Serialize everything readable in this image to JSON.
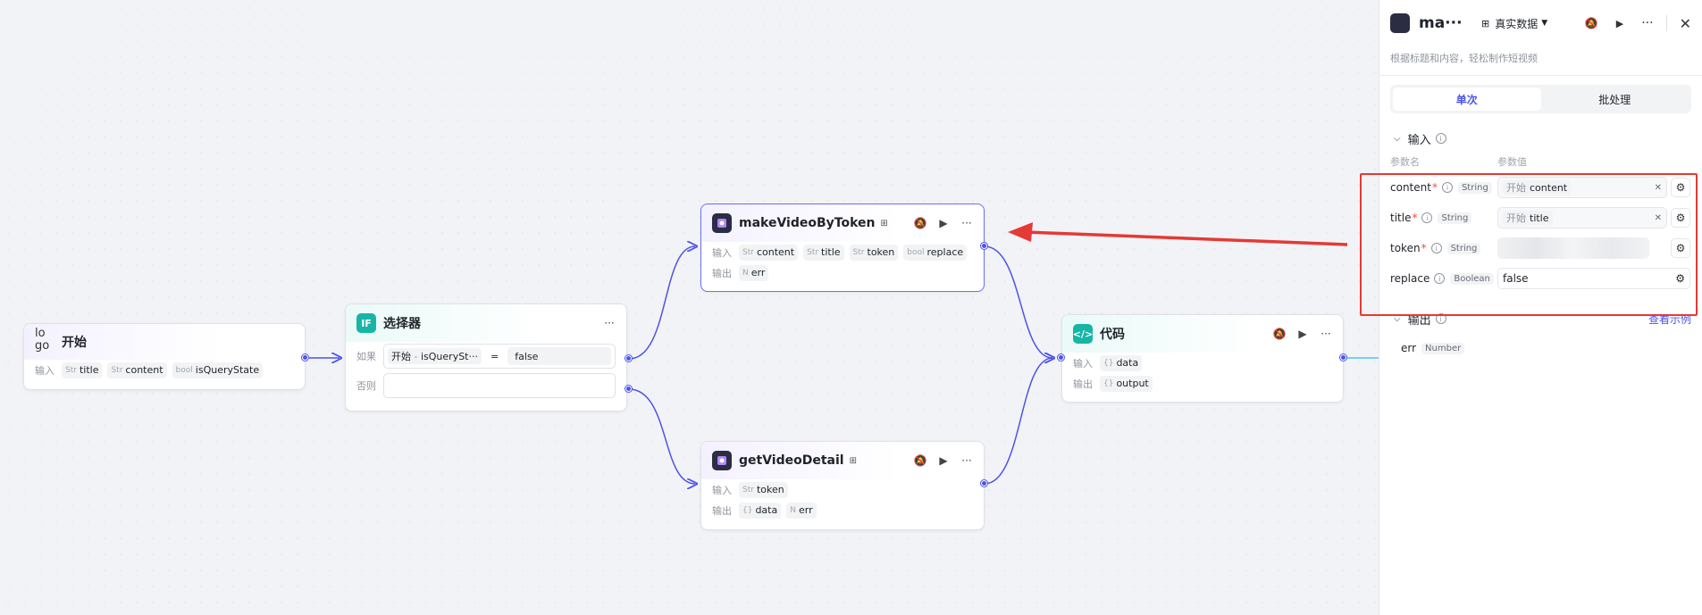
{
  "nodes": {
    "start": {
      "title": "开始",
      "broken_img_alt": "lo go",
      "input_label": "输入",
      "inputs": [
        {
          "type": "Str",
          "name": "title"
        },
        {
          "type": "Str",
          "name": "content"
        },
        {
          "type": "bool",
          "name": "isQueryState"
        }
      ]
    },
    "selector": {
      "title": "选择器",
      "icon_text": "IF",
      "if_label": "如果",
      "else_label": "否则",
      "condition": {
        "source": "开始",
        "sep": "-",
        "var": "isQuerySt···",
        "op": "=",
        "value": "false"
      }
    },
    "makeVideo": {
      "title": "makeVideoByToken",
      "input_label": "输入",
      "output_label": "输出",
      "inputs": [
        {
          "type": "Str",
          "name": "content"
        },
        {
          "type": "Str",
          "name": "title"
        },
        {
          "type": "Str",
          "name": "token"
        },
        {
          "type": "bool",
          "name": "replace"
        }
      ],
      "outputs": [
        {
          "type": "N",
          "name": "err"
        }
      ]
    },
    "getVideo": {
      "title": "getVideoDetail",
      "input_label": "输入",
      "output_label": "输出",
      "inputs": [
        {
          "type": "Str",
          "name": "token"
        }
      ],
      "outputs": [
        {
          "type": "{}",
          "name": "data"
        },
        {
          "type": "N",
          "name": "err"
        }
      ]
    },
    "code": {
      "title": "代码",
      "input_label": "输入",
      "output_label": "输出",
      "inputs": [
        {
          "type": "{}",
          "name": "data"
        }
      ],
      "outputs": [
        {
          "type": "{}",
          "name": "output"
        }
      ]
    }
  },
  "panel": {
    "title": "ma···",
    "mode": "真实数据",
    "description": "根据标题和内容，轻松制作短视频",
    "tabs": [
      "单次",
      "批处理"
    ],
    "input_section": "输入",
    "col_name": "参数名",
    "col_value": "参数值",
    "params": [
      {
        "name": "content",
        "required": true,
        "type": "String",
        "ref_src": "开始",
        "ref_name": "content"
      },
      {
        "name": "title",
        "required": true,
        "type": "String",
        "ref_src": "开始",
        "ref_name": "title"
      },
      {
        "name": "token",
        "required": true,
        "type": "String",
        "ref_src": "",
        "ref_name": ""
      },
      {
        "name": "replace",
        "required": false,
        "type": "Boolean",
        "value": "false"
      }
    ],
    "output_section": "输出",
    "view_example": "查看示例",
    "outputs": [
      {
        "name": "err",
        "type": "Number"
      }
    ]
  },
  "colors": {
    "accent": "#4d53e8",
    "annotation": "#e53935",
    "teal": "#17b5a6"
  }
}
